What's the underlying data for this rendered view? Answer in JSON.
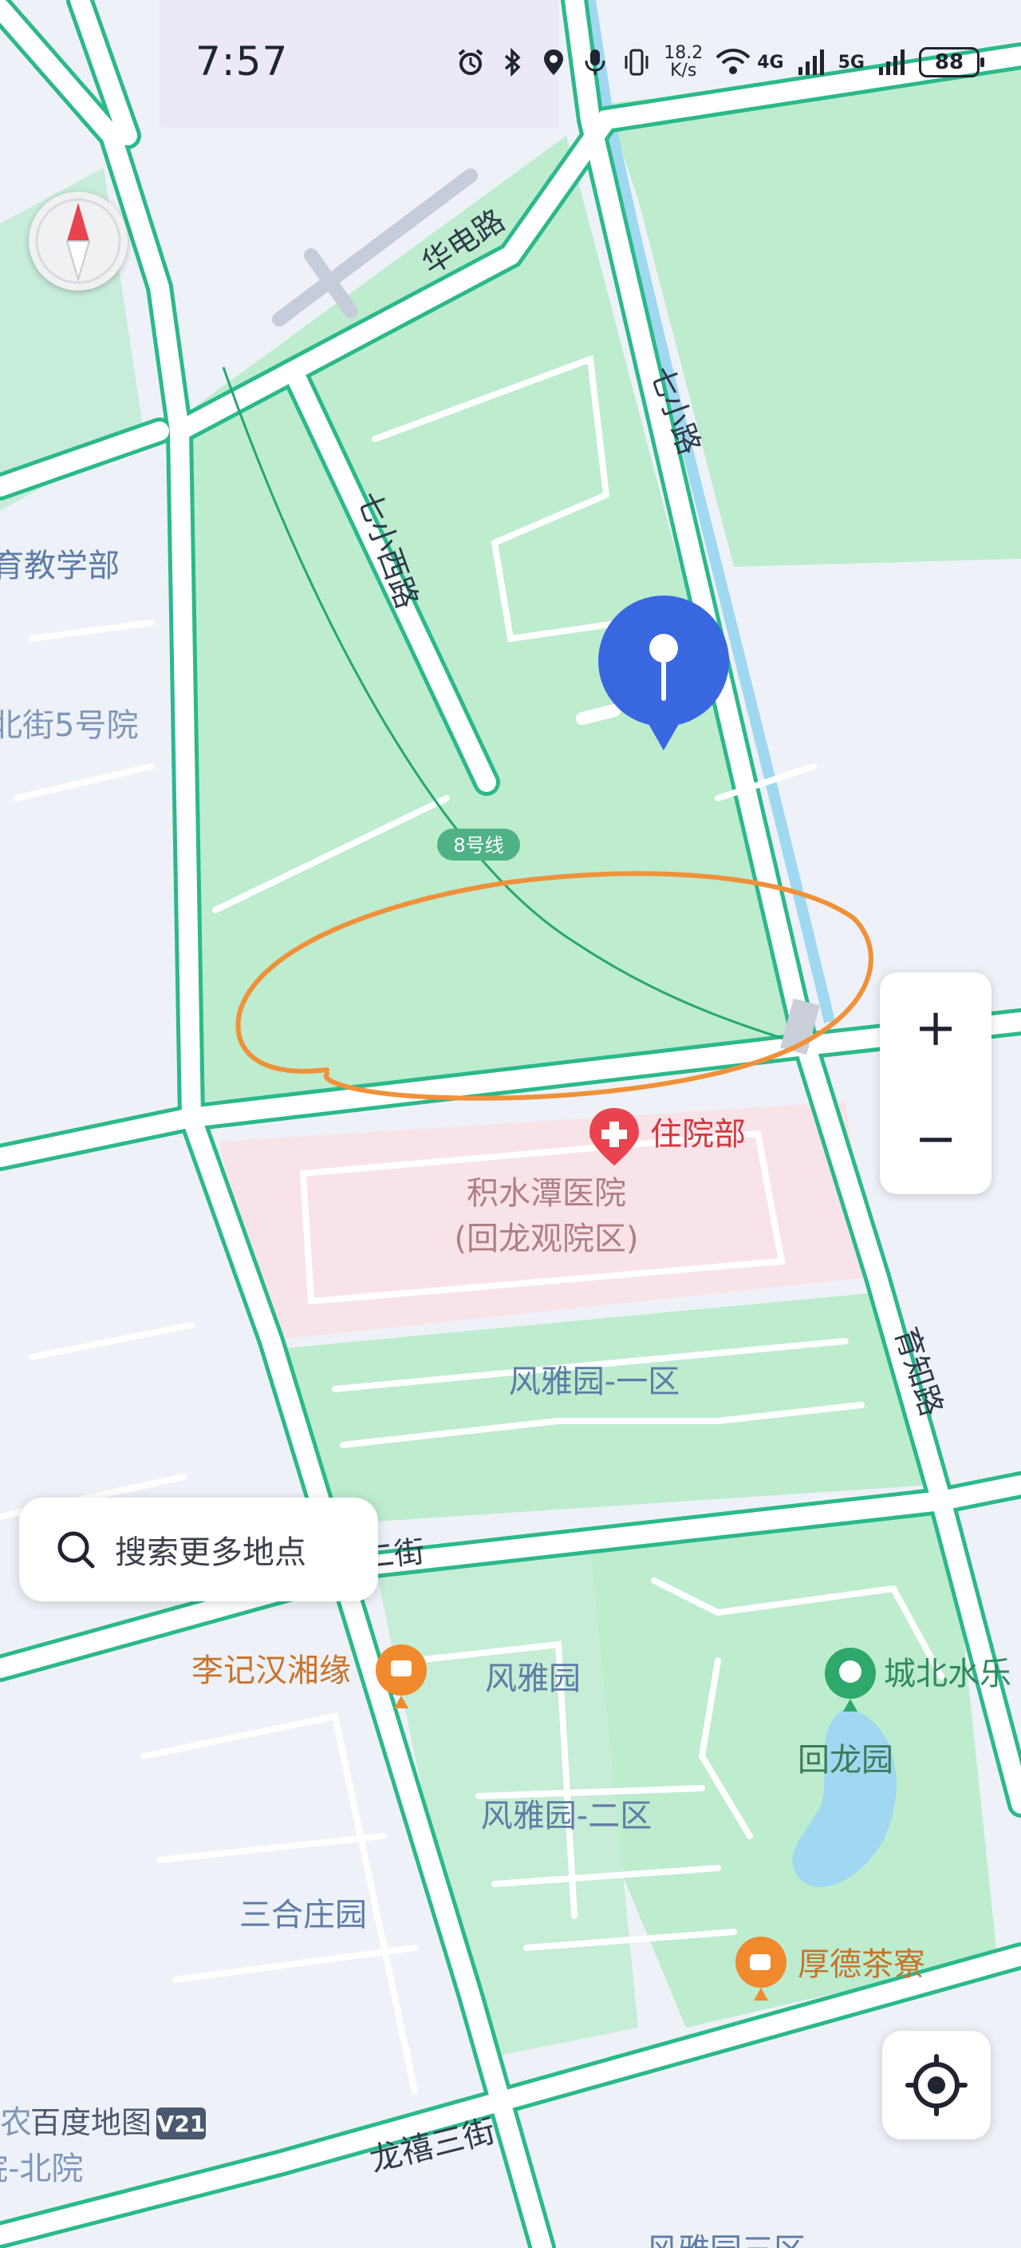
{
  "status_bar": {
    "time": "7:57",
    "network_speed_value": "18.2",
    "network_speed_unit": "K/s",
    "network_1": "4G",
    "network_2": "5G",
    "battery": "88"
  },
  "map_labels": {
    "road_huadian": "华电路",
    "road_qixiao": "七小路",
    "road_qixiao_west": "七小西路",
    "metro_line": "8号线",
    "inpatient": "住院部",
    "hospital_name": "积水潭医院",
    "hospital_campus": "(回龙观院区)",
    "fengyayuan_1": "风雅园-一区",
    "road_yuzhi": "育知路",
    "street_2": "喜二街",
    "restaurant": "李记汉湘缘",
    "fengyayuan": "风雅园",
    "chengbei": "城北水乐",
    "huilongyuan": "回龙园",
    "fengyayuan_2": "风雅园-二区",
    "sanhezhuang": "三合庄园",
    "tea_house": "厚德茶寮",
    "street_3": "龙禧三街",
    "left_teaching": "育教学部",
    "left_courtyard": "北街5号院",
    "left_bottom_1": "农",
    "left_bottom_2": "院-北院",
    "bottom_partial": "风雅园三区"
  },
  "brand": {
    "name": "百度地图",
    "version": "V21"
  },
  "controls": {
    "zoom_in": "+",
    "zoom_out": "−",
    "search_placeholder": "搜索更多地点"
  },
  "colors": {
    "road_edge": "#2bb98a",
    "park_green": "#bdeccf",
    "hospital_pink": "#f8e4e8",
    "river_blue": "#9fd8f0",
    "pin_blue": "#3867e0",
    "annotation_orange": "#f0913a",
    "poi_red": "#e8434e",
    "poi_orange": "#f08a2c",
    "poi_green": "#2ea86b",
    "label_blue": "#5d7ca6"
  }
}
